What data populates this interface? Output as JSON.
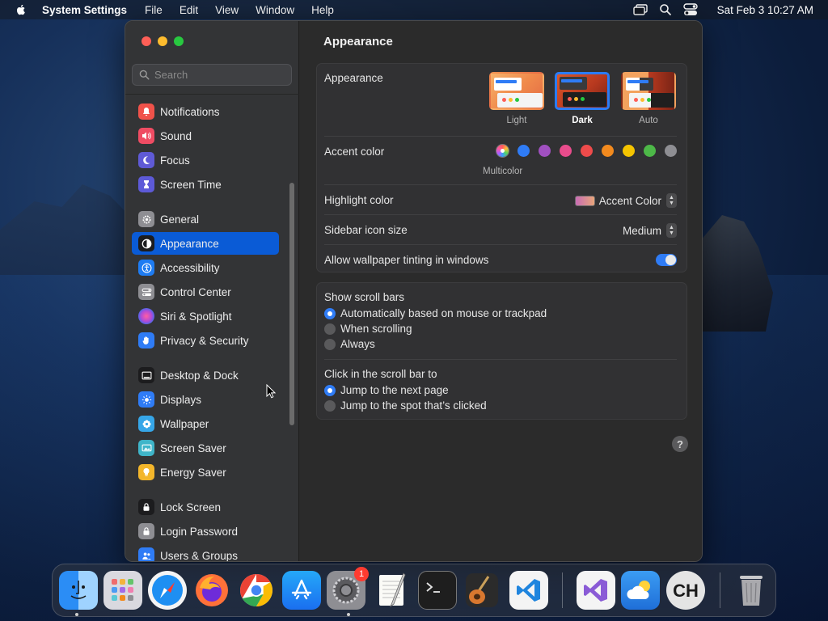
{
  "menubar": {
    "app_name": "System Settings",
    "menus": [
      "File",
      "Edit",
      "View",
      "Window",
      "Help"
    ],
    "clock": "Sat Feb 3  10:27 AM",
    "icons": [
      "screen-mirroring-icon",
      "spotlight-search-icon",
      "control-center-icon"
    ]
  },
  "search": {
    "placeholder": "Search",
    "value": ""
  },
  "sidebar": {
    "selected": "Appearance",
    "items": [
      {
        "label": "Notifications",
        "icon": "bell-icon",
        "color": "#f0524a"
      },
      {
        "label": "Sound",
        "icon": "speaker-icon",
        "color": "#ef4c63"
      },
      {
        "label": "Focus",
        "icon": "moon-icon",
        "color": "#5f5ad6"
      },
      {
        "label": "Screen Time",
        "icon": "hourglass-icon",
        "color": "#5d5ad8"
      },
      {
        "label": "General",
        "icon": "gear-icon",
        "color": "#8e8e93"
      },
      {
        "label": "Appearance",
        "icon": "appearance-icon",
        "color": "#1c1c1e"
      },
      {
        "label": "Accessibility",
        "icon": "accessibility-icon",
        "color": "#1e7cf2"
      },
      {
        "label": "Control Center",
        "icon": "toggles-icon",
        "color": "#8e8e93"
      },
      {
        "label": "Siri & Spotlight",
        "icon": "siri-icon",
        "color": "#b34bd6"
      },
      {
        "label": "Privacy & Security",
        "icon": "hand-icon",
        "color": "#2f7cf6"
      },
      {
        "label": "Desktop & Dock",
        "icon": "dock-icon",
        "color": "#1c1c1e"
      },
      {
        "label": "Displays",
        "icon": "sun-icon",
        "color": "#2f7cf6"
      },
      {
        "label": "Wallpaper",
        "icon": "flower-icon",
        "color": "#36a6e8"
      },
      {
        "label": "Screen Saver",
        "icon": "screen-saver-icon",
        "color": "#3fb5c9"
      },
      {
        "label": "Energy Saver",
        "icon": "bulb-icon",
        "color": "#f3b62b"
      },
      {
        "label": "Lock Screen",
        "icon": "lock-icon",
        "color": "#1c1c1e"
      },
      {
        "label": "Login Password",
        "icon": "padlock-icon",
        "color": "#8e8e93"
      },
      {
        "label": "Users & Groups",
        "icon": "users-icon",
        "color": "#2f7cf6"
      }
    ]
  },
  "content": {
    "title": "Appearance",
    "appearance": {
      "label": "Appearance",
      "options": [
        {
          "caption": "Light",
          "selected": false
        },
        {
          "caption": "Dark",
          "selected": true
        },
        {
          "caption": "Auto",
          "selected": false
        }
      ]
    },
    "accent": {
      "label": "Accent color",
      "caption": "Multicolor",
      "colors": [
        "multicolor",
        "#2f7cf6",
        "#a050c0",
        "#e94c8c",
        "#ee4b4b",
        "#f28a1e",
        "#f5c400",
        "#4db848",
        "#8e8e93"
      ],
      "selected_index": 0
    },
    "highlight": {
      "label": "Highlight color",
      "value": "Accent Color"
    },
    "icon_size": {
      "label": "Sidebar icon size",
      "value": "Medium"
    },
    "tinting": {
      "label": "Allow wallpaper tinting in windows",
      "enabled": true
    },
    "scrollbars": {
      "label": "Show scroll bars",
      "options": [
        "Automatically based on mouse or trackpad",
        "When scrolling",
        "Always"
      ],
      "selected_index": 0
    },
    "click_scroll": {
      "label": "Click in the scroll bar to",
      "options": [
        "Jump to the next page",
        "Jump to the spot that’s clicked"
      ],
      "selected_index": 0
    },
    "help": "?"
  },
  "dock": {
    "apps": [
      "Finder",
      "Launchpad",
      "Safari",
      "Firefox",
      "Chrome",
      "App Store",
      "System Settings",
      "TextEdit",
      "Terminal",
      "GarageBand",
      "Visual Studio Code",
      "Visual Studio",
      "Weather",
      "CH",
      "Trash"
    ],
    "badge": "1"
  }
}
